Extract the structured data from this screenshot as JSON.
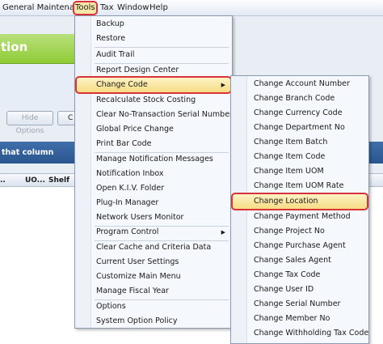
{
  "menubar": {
    "general_maintenance": "General Maintenance",
    "tools": "Tools",
    "tax": "Tax",
    "window": "Window",
    "help": "Help"
  },
  "background": {
    "banner_text": "tion",
    "hide_options": "Hide Options",
    "btn_c": "C",
    "group_bar_text": "that column",
    "grid_columns": [
      "UO...",
      "Shelf"
    ]
  },
  "tools_menu": {
    "items": [
      "Backup",
      "Restore",
      "Audit Trail",
      "Report Design Center",
      "Change Code",
      "Recalculate Stock Costing",
      "Clear No-Transaction Serial Numbers",
      "Global Price Change",
      "Print Bar Code",
      "Manage Notification Messages",
      "Notification Inbox",
      "Open K.I.V. Folder",
      "Plug-In Manager",
      "Network Users Monitor",
      "Program Control",
      "Clear Cache and Criteria Data",
      "Current User Settings",
      "Customize Main Menu",
      "Manage Fiscal Year",
      "Options",
      "System Option Policy"
    ]
  },
  "change_code_menu": {
    "items": [
      "Change Account Number",
      "Change Branch Code",
      "Change Currency Code",
      "Change Department No",
      "Change Item Batch",
      "Change Item Code",
      "Change Item UOM",
      "Change Item UOM Rate",
      "Change Location",
      "Change Payment Method",
      "Change Project No",
      "Change Purchase Agent",
      "Change Sales Agent",
      "Change Tax Code",
      "Change User ID",
      "Change Serial Number",
      "Change Member No",
      "Change Withholding Tax Code"
    ]
  },
  "colors": {
    "highlight_border": "#d8333a",
    "highlight_fill": "#f7dc83",
    "banner_green": "#8fcc35",
    "group_bar_blue": "#2b5690"
  },
  "icons": {
    "submenu_arrow": "submenu-arrow-icon"
  }
}
